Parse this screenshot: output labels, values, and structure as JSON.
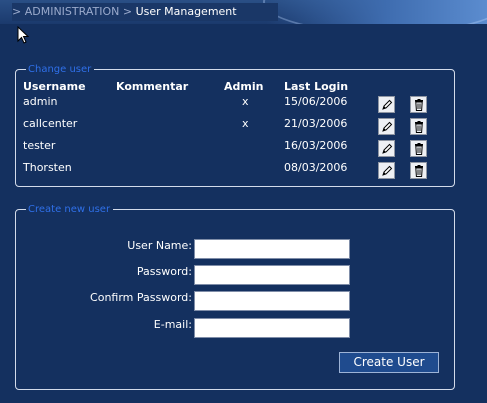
{
  "breadcrumb": {
    "items": [
      {
        "separator": ">",
        "label": "ADMINISTRATION"
      },
      {
        "separator": ">",
        "label": "User Management"
      }
    ]
  },
  "change_user": {
    "legend": "Change user",
    "columns": [
      "Username",
      "Kommentar",
      "Admin",
      "Last Login"
    ],
    "rows": [
      {
        "username": "admin",
        "comment": "",
        "admin": "x",
        "last_login": "15/06/2006"
      },
      {
        "username": "callcenter",
        "comment": "",
        "admin": "x",
        "last_login": "21/03/2006"
      },
      {
        "username": "tester",
        "comment": "",
        "admin": "",
        "last_login": "16/03/2006"
      },
      {
        "username": "Thorsten",
        "comment": "",
        "admin": "",
        "last_login": "08/03/2006"
      }
    ],
    "row_actions": [
      "edit-icon",
      "delete-icon"
    ]
  },
  "create_user": {
    "legend": "Create new user",
    "fields": [
      {
        "label": "User Name:",
        "value": "",
        "placeholder": ""
      },
      {
        "label": "Password:",
        "value": "",
        "placeholder": ""
      },
      {
        "label": "Confirm Password:",
        "value": "",
        "placeholder": ""
      },
      {
        "label": "E-mail:",
        "value": "",
        "placeholder": ""
      }
    ],
    "submit_label": "Create User"
  },
  "colors": {
    "background": "#14305f",
    "legend_text": "#2f6fe8",
    "panel_border": "#d3dbea",
    "breadcrumb_inactive": "#9aaacc"
  }
}
